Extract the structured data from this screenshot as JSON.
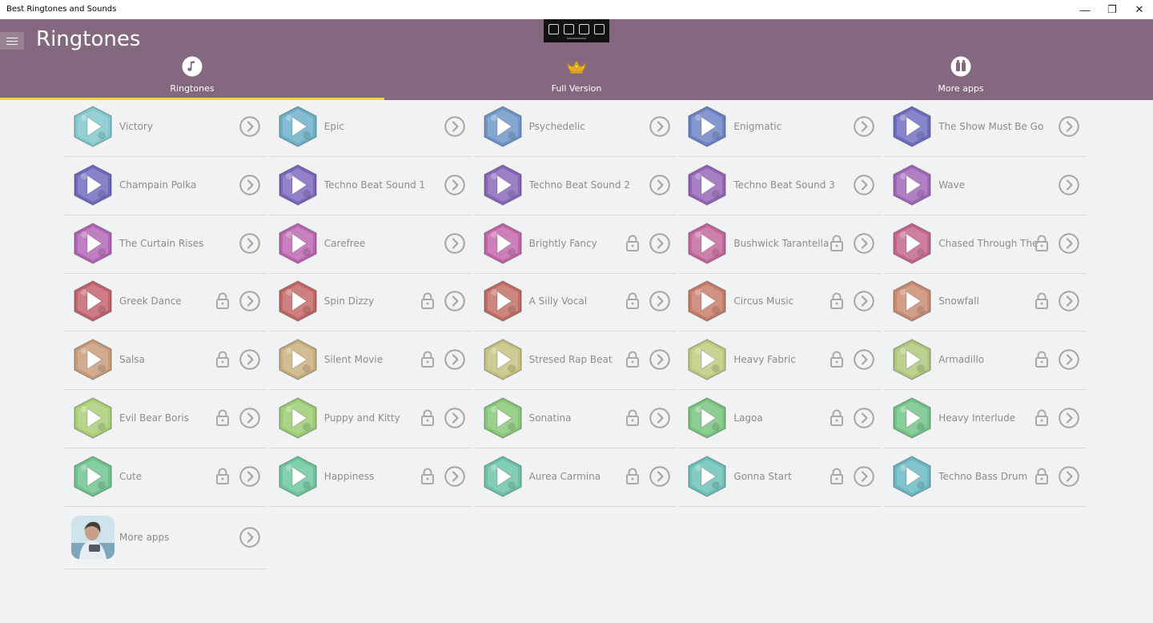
{
  "window": {
    "title": "Best Ringtones and Sounds",
    "controls": {
      "minimize": "—",
      "maximize": "❐",
      "close": "✕"
    }
  },
  "header": {
    "title": "Ringtones",
    "bg_color": "#84687f",
    "tabs": [
      {
        "label": "Ringtones",
        "icon": "music-note-icon",
        "selected": true
      },
      {
        "label": "Full Version",
        "icon": "crown-icon",
        "selected": false
      },
      {
        "label": "More apps",
        "icon": "apps-icon",
        "selected": false
      }
    ],
    "accent": "#f6d330"
  },
  "items": [
    {
      "label": "Victory",
      "locked": false,
      "color": "#7ec7cb"
    },
    {
      "label": "Epic",
      "locked": false,
      "color": "#6aafc7"
    },
    {
      "label": "Psychedelic",
      "locked": false,
      "color": "#6c94c9"
    },
    {
      "label": "Enigmatic",
      "locked": false,
      "color": "#6c80c6"
    },
    {
      "label": "The Show Must Be Go",
      "locked": false,
      "color": "#6d6bc0"
    },
    {
      "label": "Champain Polka",
      "locked": false,
      "color": "#6e67bd"
    },
    {
      "label": "Techno Beat Sound 1",
      "locked": false,
      "color": "#7a64bc"
    },
    {
      "label": "Techno Beat Sound 2",
      "locked": false,
      "color": "#8764ba"
    },
    {
      "label": "Techno Beat Sound 3",
      "locked": false,
      "color": "#9463b9"
    },
    {
      "label": "Wave",
      "locked": false,
      "color": "#a064b8"
    },
    {
      "label": "The Curtain Rises",
      "locked": false,
      "color": "#b263b5"
    },
    {
      "label": "Carefree",
      "locked": false,
      "color": "#bb63b0"
    },
    {
      "label": "Brightly Fancy",
      "locked": true,
      "color": "#c263aa"
    },
    {
      "label": "Bushwick Tarantella",
      "locked": true,
      "color": "#c4649c"
    },
    {
      "label": "Chased Through The",
      "locked": true,
      "color": "#c4638d"
    },
    {
      "label": "Greek Dance",
      "locked": true,
      "color": "#c2606b"
    },
    {
      "label": "Spin Dizzy",
      "locked": true,
      "color": "#c26563"
    },
    {
      "label": "A Silly Vocal",
      "locked": true,
      "color": "#c26c61"
    },
    {
      "label": "Circus Music",
      "locked": true,
      "color": "#c77b66"
    },
    {
      "label": "Snowfall",
      "locked": true,
      "color": "#c8896e"
    },
    {
      "label": "Salsa",
      "locked": true,
      "color": "#c99a78"
    },
    {
      "label": "Silent Movie",
      "locked": true,
      "color": "#c8ae7c"
    },
    {
      "label": "Stresed Rap Beat",
      "locked": true,
      "color": "#c5c07d"
    },
    {
      "label": "Heavy Fabric",
      "locked": true,
      "color": "#bfc97d"
    },
    {
      "label": "Armadillo",
      "locked": true,
      "color": "#aec679"
    },
    {
      "label": "Evil Bear Boris",
      "locked": true,
      "color": "#a8cd72"
    },
    {
      "label": "Puppy and Kitty",
      "locked": true,
      "color": "#98cb71"
    },
    {
      "label": "Sonatina",
      "locked": true,
      "color": "#85c774"
    },
    {
      "label": "Lagoa",
      "locked": true,
      "color": "#77c47c"
    },
    {
      "label": "Heavy Interlude",
      "locked": true,
      "color": "#70c386"
    },
    {
      "label": "Cute",
      "locked": true,
      "color": "#6cc38e"
    },
    {
      "label": "Happiness",
      "locked": true,
      "color": "#6ac59b"
    },
    {
      "label": "Aurea Carmina",
      "locked": true,
      "color": "#69c2a8"
    },
    {
      "label": "Gonna Start",
      "locked": true,
      "color": "#68c0b6"
    },
    {
      "label": "Techno Bass Drum",
      "locked": true,
      "color": "#66b8c4"
    }
  ],
  "more_apps_item": {
    "label": "More apps"
  }
}
